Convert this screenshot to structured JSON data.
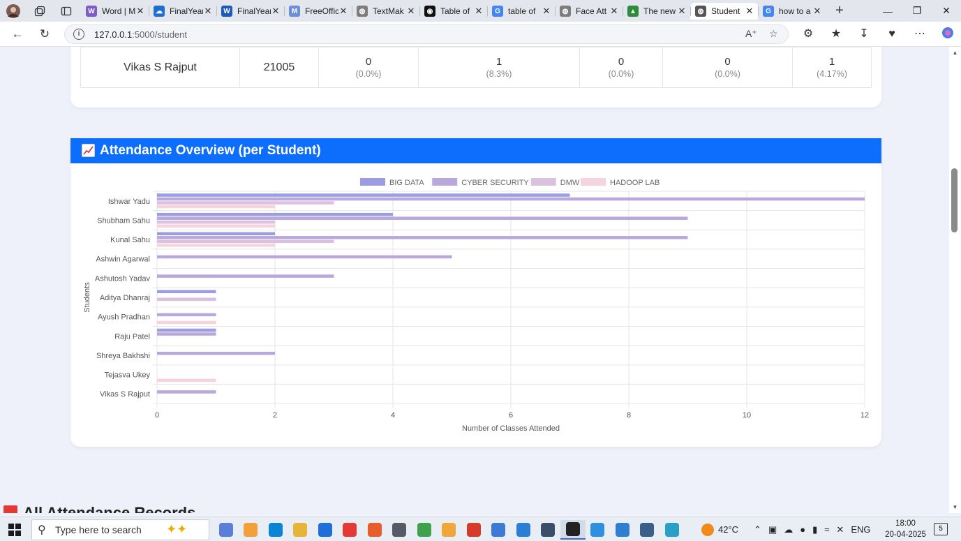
{
  "browser": {
    "tabs": [
      {
        "title": "Word | M",
        "color": "#7b5cc9",
        "glyph": "W",
        "active": false
      },
      {
        "title": "FinalYear",
        "color": "#1f6fd1",
        "glyph": "☁",
        "active": false
      },
      {
        "title": "FinalYear",
        "color": "#1e5bb8",
        "glyph": "W",
        "active": false
      },
      {
        "title": "FreeOffic",
        "color": "#6a8fd6",
        "glyph": "M",
        "active": false
      },
      {
        "title": "TextMak",
        "color": "#7d7d7d",
        "glyph": "◍",
        "active": false
      },
      {
        "title": "Table of",
        "color": "#111111",
        "glyph": "◉",
        "active": false
      },
      {
        "title": "table of",
        "color": "#4285f4",
        "glyph": "G",
        "active": false
      },
      {
        "title": "Face Att",
        "color": "#7d7d7d",
        "glyph": "◍",
        "active": false
      },
      {
        "title": "The new",
        "color": "#2e8b3c",
        "glyph": "▲",
        "active": false
      },
      {
        "title": "Student",
        "color": "#555555",
        "glyph": "◍",
        "active": true
      },
      {
        "title": "how to a",
        "color": "#4285f4",
        "glyph": "G",
        "active": false
      }
    ],
    "url_host": "127.0.0.1",
    "url_path": ":5000/student"
  },
  "summary_row": {
    "name": "Vikas S Rajput",
    "roll": "21005",
    "cells": [
      {
        "count": "0",
        "pct": "(0.0%)"
      },
      {
        "count": "1",
        "pct": "(8.3%)"
      },
      {
        "count": "0",
        "pct": "(0.0%)"
      },
      {
        "count": "0",
        "pct": "(0.0%)"
      },
      {
        "count": "1",
        "pct": "(4.17%)"
      }
    ]
  },
  "chart_card": {
    "title": "Attendance Overview (per Student)"
  },
  "chart_data": {
    "type": "bar",
    "orientation": "horizontal",
    "categories": [
      "Ishwar Yadu",
      "Shubham Sahu",
      "Kunal Sahu",
      "Ashwin Agarwal",
      "Ashutosh Yadav",
      "Aditya Dhanraj",
      "Ayush Pradhan",
      "Raju Patel",
      "Shreya Bakhshi",
      "Tejasva Ukey",
      "Vikas S Rajput"
    ],
    "series": [
      {
        "name": "BIG DATA",
        "color": "#9c9ce2",
        "values": [
          7,
          4,
          2,
          0,
          0,
          1,
          0,
          1,
          0,
          0,
          0
        ]
      },
      {
        "name": "CYBER SECURITY",
        "color": "#b9a8dc",
        "values": [
          12,
          9,
          9,
          5,
          3,
          0,
          1,
          1,
          2,
          0,
          1
        ]
      },
      {
        "name": "DMW",
        "color": "#dcc0e0",
        "values": [
          3,
          2,
          3,
          0,
          0,
          1,
          0,
          0,
          0,
          0,
          0
        ]
      },
      {
        "name": "HADOOP LAB",
        "color": "#f6d4de",
        "values": [
          2,
          2,
          2,
          0,
          0,
          0,
          1,
          0,
          0,
          1,
          0
        ]
      }
    ],
    "xlabel": "Number of Classes Attended",
    "ylabel": "Students",
    "xlim": [
      0,
      12
    ],
    "xticks": [
      0,
      2,
      4,
      6,
      8,
      10,
      12
    ],
    "grid": true,
    "legend_position": "top"
  },
  "next_section": {
    "title": "All Attendance Records"
  },
  "taskbar": {
    "search_placeholder": "Type here to search",
    "apps": [
      "#5b7fd9",
      "#f2a03a",
      "#0a84d6",
      "#e8b339",
      "#1e6fd9",
      "#e53935",
      "#e85d2a",
      "#555b66",
      "#3fa24a",
      "#f0a73a",
      "#d63a2a",
      "#3b7bd6",
      "#2a7fd4",
      "#3a4f6a",
      "#222222",
      "#2f8fe0",
      "#2f7fd0",
      "#3a5f8a",
      "#2aa0c8"
    ],
    "active_app_index": 14,
    "weather": "42°C",
    "language": "ENG",
    "time": "18:00",
    "date": "20-04-2025",
    "notifications": "5"
  }
}
